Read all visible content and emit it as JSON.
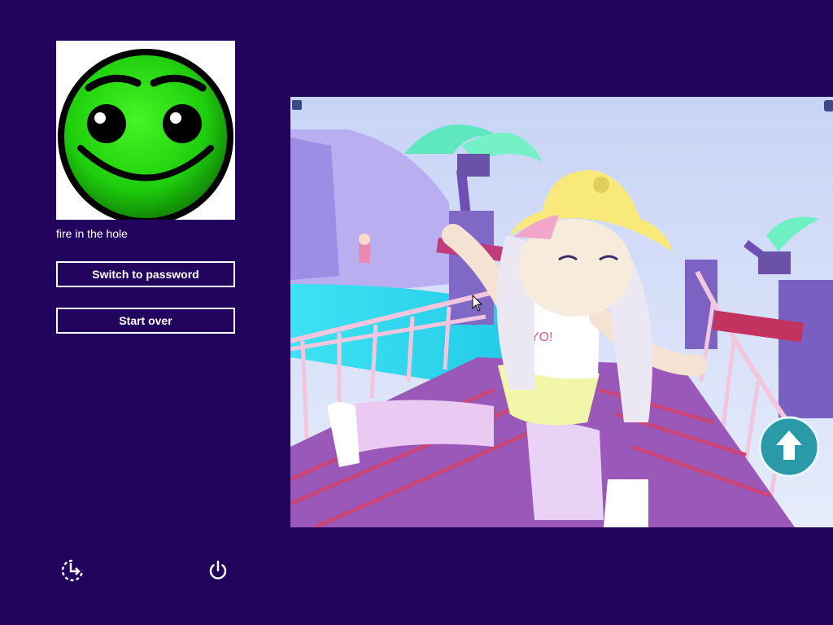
{
  "user": {
    "name": "fire in the hole",
    "avatar_icon": "green-smiley-face-icon"
  },
  "actions": {
    "switch_label": "Switch to password",
    "start_over_label": "Start over"
  },
  "picture": {
    "description_icon": "picture-password-image"
  },
  "bottom_bar": {
    "ease_of_access_icon": "ease-of-access-icon",
    "power_icon": "power-icon"
  },
  "colors": {
    "background": "#22045f",
    "avatar_green": "#22d80f",
    "text": "#ffffff"
  }
}
